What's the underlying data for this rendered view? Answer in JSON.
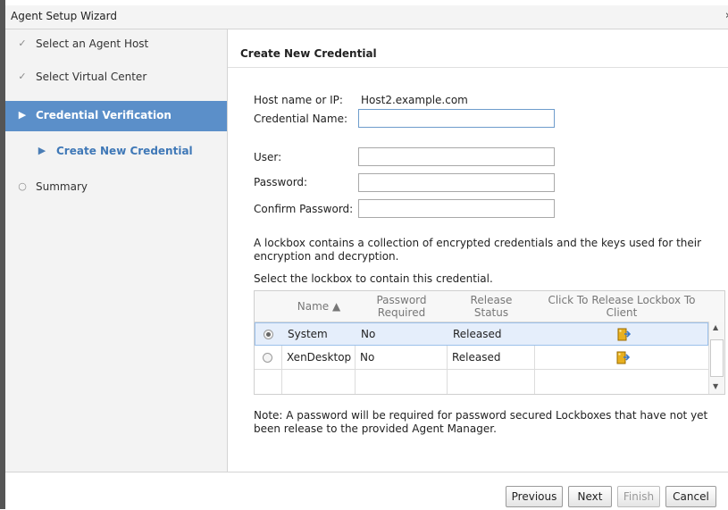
{
  "window": {
    "title": "Agent Setup Wizard",
    "close_glyph": "›"
  },
  "steps": [
    {
      "label": "Select an Agent Host",
      "icon": "checkmark-icon",
      "state": "done"
    },
    {
      "label": "Select Virtual Center",
      "icon": "checkmark-icon",
      "state": "done"
    },
    {
      "label": "Credential Verification",
      "icon": "triangle-right-icon",
      "state": "active"
    },
    {
      "label": "Create New Credential",
      "icon": "triangle-right-icon",
      "state": "sub"
    },
    {
      "label": "Summary",
      "icon": "circle-icon",
      "state": "pending"
    }
  ],
  "panel": {
    "title": "Create New Credential",
    "host_label": "Host name or IP:",
    "host_value": "Host2.example.com",
    "credential_name_label": "Credential Name:",
    "credential_name_value": "",
    "user_label": "User:",
    "user_value": "",
    "password_label": "Password:",
    "password_value": "",
    "confirm_label": "Confirm Password:",
    "confirm_value": "",
    "lockbox_desc_1": "A lockbox contains a collection of encrypted credentials and the keys used for their",
    "lockbox_desc_2": "encryption and decryption.",
    "lockbox_select": "Select the lockbox to contain this credential.",
    "note_1": "Note: A password will be required for password secured Lockboxes that have not yet",
    "note_2": "been release to the provided Agent Manager."
  },
  "grid": {
    "headers": {
      "name": "Name ▲",
      "password_1": "Password",
      "password_2": "Required",
      "release_1": "Release",
      "release_2": "Status",
      "click_1": "Click To Release Lockbox To",
      "click_2": "Client"
    },
    "rows": [
      {
        "name": "System",
        "password_required": "No",
        "release_status": "Released",
        "selected": true
      },
      {
        "name": "XenDesktop",
        "password_required": "No",
        "release_status": "Released",
        "selected": false
      }
    ]
  },
  "buttons": {
    "previous": "Previous",
    "next": "Next",
    "finish": "Finish",
    "cancel": "Cancel"
  },
  "colors": {
    "accent": "#5b8fc9",
    "sub_step": "#3f78b7",
    "lockbox_icon": "#e8b020"
  }
}
